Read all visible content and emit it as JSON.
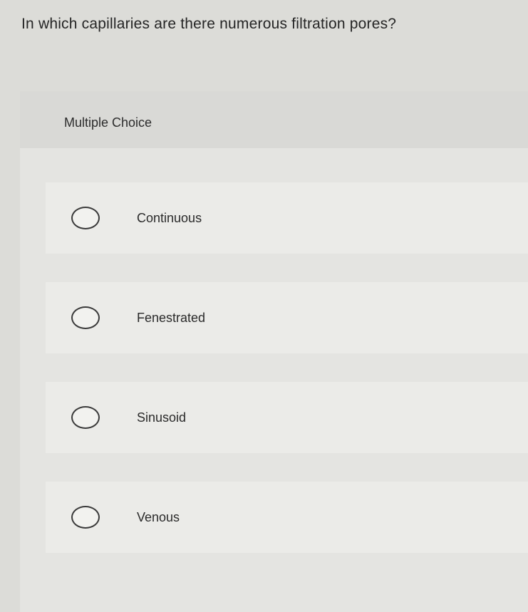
{
  "question": {
    "text": "In which capillaries are there numerous filtration pores?"
  },
  "answer_panel": {
    "type_label": "Multiple Choice",
    "options": [
      {
        "label": "Continuous",
        "selected": false
      },
      {
        "label": "Fenestrated",
        "selected": false
      },
      {
        "label": "Sinusoid",
        "selected": false
      },
      {
        "label": "Venous",
        "selected": false
      }
    ]
  }
}
